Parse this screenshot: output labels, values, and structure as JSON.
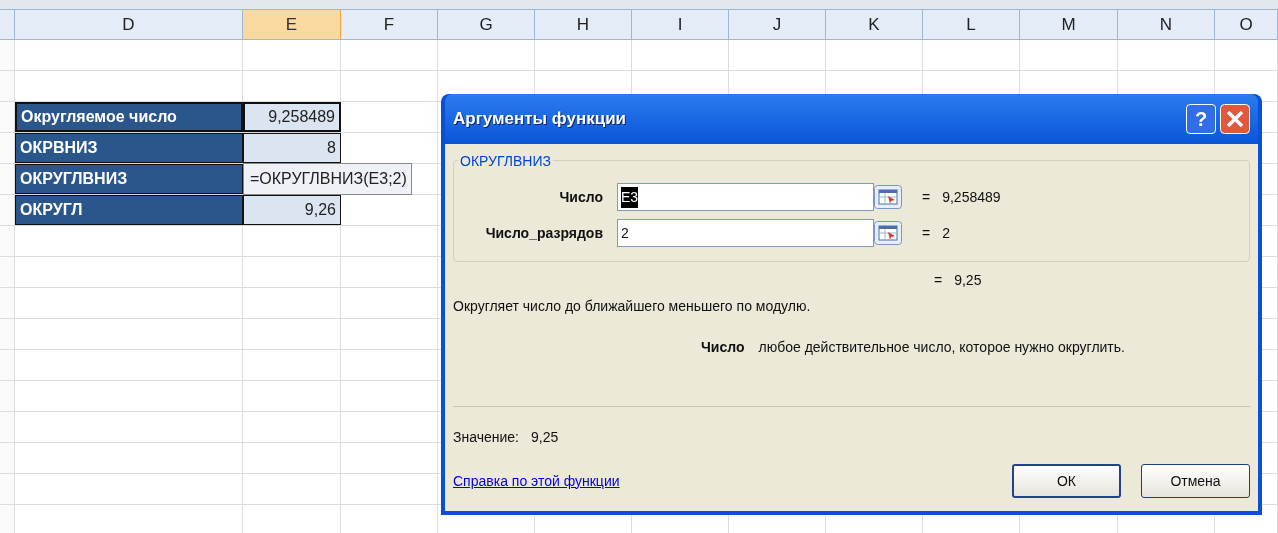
{
  "columns": [
    {
      "label": "D",
      "selected": false
    },
    {
      "label": "E",
      "selected": true
    },
    {
      "label": "F",
      "selected": false
    },
    {
      "label": "G",
      "selected": false
    },
    {
      "label": "H",
      "selected": false
    },
    {
      "label": "I",
      "selected": false
    },
    {
      "label": "J",
      "selected": false
    },
    {
      "label": "K",
      "selected": false
    },
    {
      "label": "L",
      "selected": false
    },
    {
      "label": "M",
      "selected": false
    },
    {
      "label": "N",
      "selected": false
    },
    {
      "label": "O",
      "selected": false
    }
  ],
  "table": [
    {
      "label": "Округляемое число",
      "value": "9,258489",
      "editing": false
    },
    {
      "label": "ОКРВНИЗ",
      "value": "8",
      "editing": false
    },
    {
      "label": "ОКРУГЛВНИЗ",
      "value": "=ОКРУГЛВНИЗ(E3;2)",
      "editing": true
    },
    {
      "label": "ОКРУГЛ",
      "value": "9,26",
      "editing": false
    }
  ],
  "dialog": {
    "title": "Аргументы функции",
    "help_button": "?",
    "function_name": "ОКРУГЛВНИЗ",
    "fields": [
      {
        "label": "Число",
        "value": "E3",
        "highlighted": true,
        "equals": "=",
        "result": "9,258489"
      },
      {
        "label": "Число_разрядов",
        "value": "2",
        "highlighted": false,
        "equals": "=",
        "result": "2"
      }
    ],
    "formula_result": {
      "equals": "=",
      "value": "9,25"
    },
    "description": "Округляет число до ближайшего меньшего по модулю.",
    "argument_help": {
      "name": "Число",
      "text": "любое действительное число, которое нужно округлить."
    },
    "value_label": "Значение:",
    "value": "9,25",
    "help_link": "Справка по этой функции",
    "buttons": [
      {
        "label": "ОК",
        "default": true
      },
      {
        "label": "Отмена",
        "default": false
      }
    ]
  }
}
